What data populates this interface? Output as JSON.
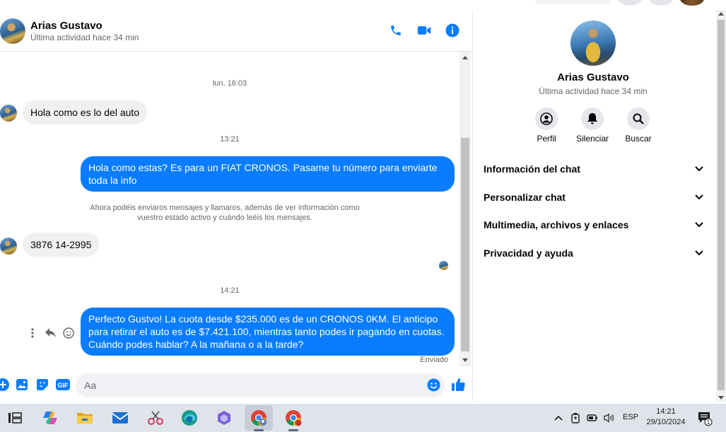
{
  "header": {
    "name": "Arias Gustavo",
    "status": "Última actividad hace 34 min",
    "icons": [
      "phone-icon",
      "video-icon",
      "info-icon"
    ]
  },
  "messages": {
    "ts1": "lun, 16:03",
    "in1": "Hola como es lo del auto",
    "ts2": "13:21",
    "out1": "Hola como estas?  Es para un FIAT CRONOS. Pasame tu número para enviarte toda la info",
    "notice_line1": "Ahora podéis enviaros mensajes y llamaros, además de ver información como",
    "notice_line2": "vuestro estado activo y cuándo leéis los mensajes.",
    "in2": "3876 14-2995",
    "ts3": "14:21",
    "out2": "Perfecto Gustvo! La cuota desde $235.000 es de un CRONOS 0KM. El anticipo para retirar el auto es de $7.421.100, mientras tanto podes ir pagando en cuotas. Cuándo podes hablar? A la mañana o a la tarde?",
    "sent_label": "Enviado"
  },
  "composer": {
    "placeholder": "Aa",
    "icons": [
      "plus-icon",
      "photo-icon",
      "sticker-icon",
      "gif-icon",
      "emoji-icon",
      "thumbs-up-icon"
    ],
    "gif_label": "GIF"
  },
  "right_panel": {
    "name": "Arias Gustavo",
    "status": "Última actividad hace 34 min",
    "actions": [
      {
        "label": "Perfil",
        "icon": "profile-icon"
      },
      {
        "label": "Silenciar",
        "icon": "bell-icon"
      },
      {
        "label": "Buscar",
        "icon": "search-icon"
      }
    ],
    "sections": [
      {
        "label": "Información del chat"
      },
      {
        "label": "Personalizar chat"
      },
      {
        "label": "Multimedia, archivos y enlaces"
      },
      {
        "label": "Privacidad y ayuda"
      }
    ]
  },
  "taskbar": {
    "apps": [
      "task-view-icon",
      "copilot-icon",
      "file-explorer-icon",
      "mail-icon",
      "snipping-tool-icon",
      "edge-icon",
      "teams-icon",
      "chrome-profile-icon",
      "chrome-icon"
    ],
    "language": "ESP",
    "time": "14:21",
    "date": "29/10/2024",
    "notification_count": "1"
  },
  "colors": {
    "accent": "#0a7cff",
    "incoming_bubble": "#f0f0f0",
    "secondary_text": "#65676b",
    "taskbar": "#dfe3ea"
  }
}
